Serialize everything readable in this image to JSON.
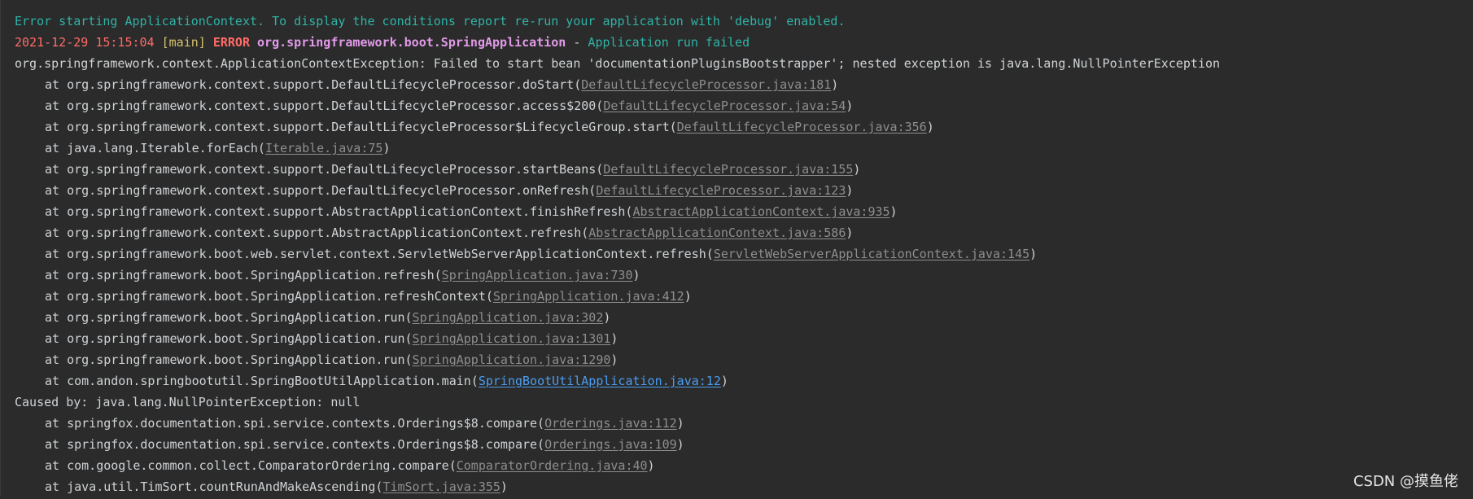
{
  "header": {
    "debug_hint": "Error starting ApplicationContext. To display the conditions report re-run your application with 'debug' enabled.",
    "log_timestamp": "2021-12-29 15:15:04",
    "log_thread": "[main]",
    "log_level": "ERROR",
    "log_logger": "org.springframework.boot.SpringApplication",
    "log_separator": " - ",
    "log_message": "Application run failed",
    "exception": "org.springframework.context.ApplicationContextException: Failed to start bean 'documentationPluginsBootstrapper'; nested exception is java.lang.NullPointerException"
  },
  "stack": [
    {
      "pre": "at org.springframework.context.support.DefaultLifecycleProcessor.doStart(",
      "link": "DefaultLifecycleProcessor.java:181",
      "post": ")"
    },
    {
      "pre": "at org.springframework.context.support.DefaultLifecycleProcessor.access$200(",
      "link": "DefaultLifecycleProcessor.java:54",
      "post": ")"
    },
    {
      "pre": "at org.springframework.context.support.DefaultLifecycleProcessor$LifecycleGroup.start(",
      "link": "DefaultLifecycleProcessor.java:356",
      "post": ")"
    },
    {
      "pre": "at java.lang.Iterable.forEach(",
      "link": "Iterable.java:75",
      "post": ")"
    },
    {
      "pre": "at org.springframework.context.support.DefaultLifecycleProcessor.startBeans(",
      "link": "DefaultLifecycleProcessor.java:155",
      "post": ")"
    },
    {
      "pre": "at org.springframework.context.support.DefaultLifecycleProcessor.onRefresh(",
      "link": "DefaultLifecycleProcessor.java:123",
      "post": ")"
    },
    {
      "pre": "at org.springframework.context.support.AbstractApplicationContext.finishRefresh(",
      "link": "AbstractApplicationContext.java:935",
      "post": ")"
    },
    {
      "pre": "at org.springframework.context.support.AbstractApplicationContext.refresh(",
      "link": "AbstractApplicationContext.java:586",
      "post": ")"
    },
    {
      "pre": "at org.springframework.boot.web.servlet.context.ServletWebServerApplicationContext.refresh(",
      "link": "ServletWebServerApplicationContext.java:145",
      "post": ")"
    },
    {
      "pre": "at org.springframework.boot.SpringApplication.refresh(",
      "link": "SpringApplication.java:730",
      "post": ")"
    },
    {
      "pre": "at org.springframework.boot.SpringApplication.refreshContext(",
      "link": "SpringApplication.java:412",
      "post": ")"
    },
    {
      "pre": "at org.springframework.boot.SpringApplication.run(",
      "link": "SpringApplication.java:302",
      "post": ")"
    },
    {
      "pre": "at org.springframework.boot.SpringApplication.run(",
      "link": "SpringApplication.java:1301",
      "post": ")"
    },
    {
      "pre": "at org.springframework.boot.SpringApplication.run(",
      "link": "SpringApplication.java:1290",
      "post": ")"
    },
    {
      "pre": "at com.andon.springbootutil.SpringBootUtilApplication.main(",
      "link": "SpringBootUtilApplication.java:12",
      "post": ")"
    }
  ],
  "caused_by": "Caused by: java.lang.NullPointerException: null",
  "cause_stack": [
    {
      "pre": "at springfox.documentation.spi.service.contexts.Orderings$8.compare(",
      "link": "Orderings.java:112",
      "post": ")"
    },
    {
      "pre": "at springfox.documentation.spi.service.contexts.Orderings$8.compare(",
      "link": "Orderings.java:109",
      "post": ")"
    },
    {
      "pre": "at com.google.common.collect.ComparatorOrdering.compare(",
      "link": "ComparatorOrdering.java:40",
      "post": ")"
    },
    {
      "pre": "at java.util.TimSort.countRunAndMakeAscending(",
      "link": "TimSort.java:355",
      "post": ")"
    }
  ],
  "watermark": "CSDN @摸鱼佬",
  "colors": {
    "background": "#2b2b2b",
    "hint": "#2fb3a6",
    "error": "#ff6b68",
    "thread": "#d6c26b",
    "logger": "#e19ae8",
    "link": "#8e8e8e",
    "user_link": "#4a9df0"
  }
}
